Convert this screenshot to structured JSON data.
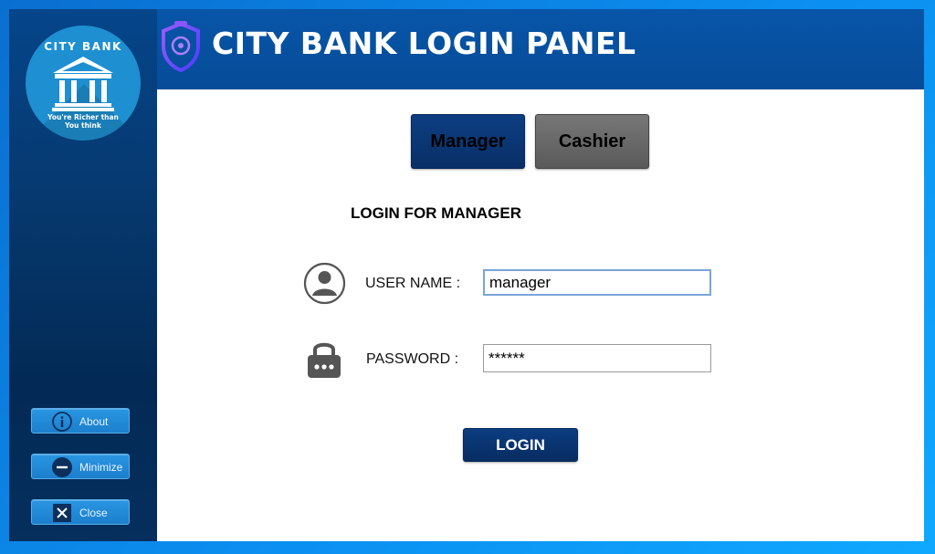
{
  "logo": {
    "title": "CITY BANK",
    "tagline_line1": "You're Richer than",
    "tagline_line2": "You think",
    "icon": "bank-building-icon"
  },
  "header": {
    "title": "CITY BANK LOGIN PANEL",
    "icon": "security-shield-icon"
  },
  "sidebar": {
    "buttons": [
      {
        "label": "About",
        "icon": "info-icon"
      },
      {
        "label": "Minimize",
        "icon": "minus-icon"
      },
      {
        "label": "Close",
        "icon": "close-icon"
      }
    ]
  },
  "tabs": {
    "manager_label": "Manager",
    "cashier_label": "Cashier",
    "selected": "Manager"
  },
  "form": {
    "heading": "LOGIN FOR MANAGER",
    "username_label": "USER NAME :",
    "username_value": "manager",
    "password_label": "PASSWORD :",
    "password_value": "******",
    "login_label": "LOGIN"
  },
  "colors": {
    "primary_navy": "#0a3775",
    "sidebar_blue": "#05458a",
    "side_button_blue": "#1b7fcc",
    "cashier_gray": "#5a5a5a",
    "logo_circle": "#1e8fd0"
  }
}
